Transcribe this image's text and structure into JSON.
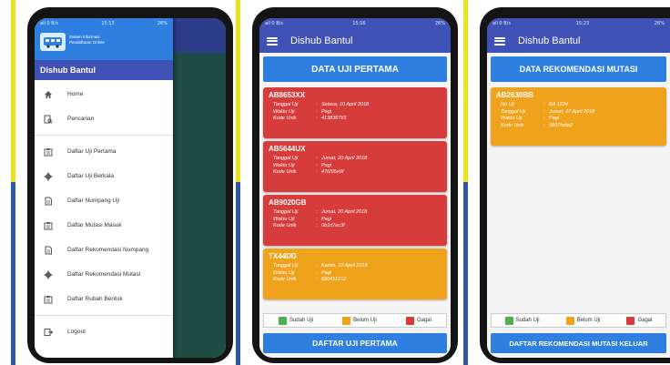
{
  "colors": {
    "primary": "#3f51b5",
    "banner": "#2f7fe0",
    "status_done": "#4caf50",
    "status_pending": "#efa21c",
    "status_fail": "#d63c3c"
  },
  "phone1": {
    "statusbar": {
      "left": "all 0 B/s",
      "time": "15:13",
      "right": "26%"
    },
    "drawer": {
      "header_text_1": "Sistem Informasi",
      "header_text_2": "Pendaftaran Online",
      "title": "Dishub Bantul",
      "items": [
        {
          "label": "Home",
          "icon": "home-icon"
        },
        {
          "label": "Pencarian",
          "icon": "search-doc-icon"
        },
        {
          "label": "Daftar Uji Pertama",
          "icon": "clipboard-icon"
        },
        {
          "label": "Daftar Uji Berkala",
          "icon": "gear-icon"
        },
        {
          "label": "Daftar Numpang Uji",
          "icon": "document-icon"
        },
        {
          "label": "Daftar Mutasi Masuk",
          "icon": "clipboard-icon"
        },
        {
          "label": "Daftar Rekomendasi Numpang",
          "icon": "document-icon"
        },
        {
          "label": "Daftar Rekomendasi Mutasi",
          "icon": "gear-icon"
        },
        {
          "label": "Daftar Rubah Bentuk",
          "icon": "clipboard-icon"
        },
        {
          "label": "Logout",
          "icon": "logout-icon"
        }
      ]
    }
  },
  "phone2": {
    "statusbar": {
      "left": "all 0 B/s",
      "time": "15:16",
      "right": "26%"
    },
    "appbar_title": "Dishub Bantul",
    "banner": "DATA UJI PERTAMA",
    "labels": {
      "tanggal": "Tanggal Uji",
      "waktu": "Waktu Uji",
      "kode": "Kode Unik",
      "sep": ":"
    },
    "cards": [
      {
        "plate": "AB8653XX",
        "tanggal": "Selasa, 10 April 2018",
        "waktu": "Pagi",
        "kode": "413836765",
        "status": "red"
      },
      {
        "plate": "AB5644UX",
        "tanggal": "Jumat, 20 April 2018",
        "waktu": "Pagi",
        "kode": "47f205e9f",
        "status": "red"
      },
      {
        "plate": "AB9020GB",
        "tanggal": "Jumat, 20 April 2018",
        "waktu": "Pagi",
        "kode": "0b1d7ec3f",
        "status": "red"
      },
      {
        "plate": "TX44DD",
        "tanggal": "Kamis, 23 April 2018",
        "waktu": "Pagi",
        "kode": "680411212",
        "status": "orange"
      }
    ],
    "legend": {
      "done": "Sudah Uji",
      "pending": "Belum Uji",
      "fail": "Gagal"
    },
    "bottom_button": "DAFTAR UJI PERTAMA"
  },
  "phone3": {
    "statusbar": {
      "left": "all 0 B/s",
      "time": "15:23",
      "right": "26%"
    },
    "appbar_title": "Dishub Bantul",
    "banner": "DATA REKOMENDASI MUTASI",
    "labels": {
      "nouji": "No Uji",
      "tanggal": "Tanggal Uji",
      "waktu": "Waktu Uji",
      "kode": "Kode Unik",
      "sep": ":"
    },
    "card": {
      "plate": "AB2630BB",
      "nouji": "BA 1224",
      "tanggal": "Jumat, 27 April 2018",
      "waktu": "Pagi",
      "kode": "9897fada2"
    },
    "legend": {
      "done": "Sudah Uji",
      "pending": "Belum Uji",
      "fail": "Gagal"
    },
    "bottom_button": "DAFTAR REKOMENDASI MUTASI KELUAR"
  }
}
